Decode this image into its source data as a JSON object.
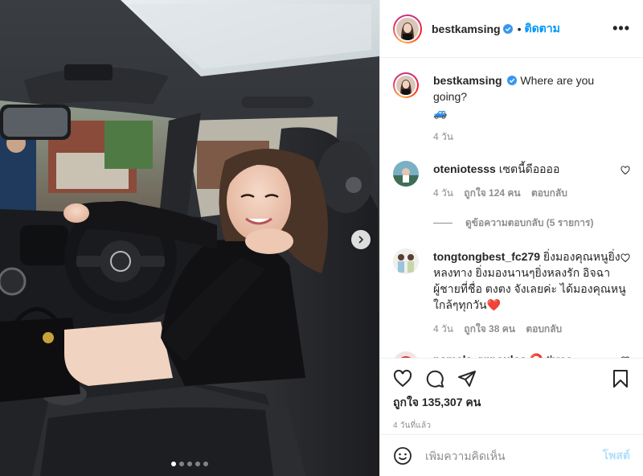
{
  "header": {
    "username": "bestkamsing",
    "dot": "•",
    "follow_label": "ติดตาม",
    "more_label": "•••"
  },
  "caption": {
    "username": "bestkamsing",
    "text": "Where are you going?",
    "emoji": "🚙",
    "time": "4 วัน"
  },
  "comments": [
    {
      "username": "oteniotesss",
      "text": "เซตนี้ดีออออ",
      "time": "4 วัน",
      "likes": "ถูกใจ 124 คน",
      "reply_label": "ตอบกลับ"
    },
    {
      "username": "tongtongbest_fc279",
      "text": "ยิ่งมองคุณหนูยิ่งหลงทาง ยิ่งมองนานๆยิ่งหลงรัก อิจฉาผู้ชายที่ชื่อ ตงตง จังเลยค่ะ ได้มองคุณหนูใกล้ๆทุกวัน",
      "emoji": "❤️",
      "time": "4 วัน",
      "likes": "ถูกใจ 38 คน",
      "reply_label": "ตอบกลับ"
    },
    {
      "username": "pamela_rgpoulos",
      "emoji": "⭕",
      "text": "three"
    }
  ],
  "view_replies": "ดูข้อความตอบกลับ (5 รายการ)",
  "actions": {
    "like_icon": "heart-icon",
    "comment_icon": "comment-icon",
    "share_icon": "share-icon",
    "save_icon": "bookmark-icon"
  },
  "likes_text": "ถูกใจ 135,307 คน",
  "posted_ago": "4 วันที่แล้ว",
  "add_comment": {
    "placeholder": "เพิ่มความคิดเห็น",
    "post_label": "โพสต์"
  },
  "carousel": {
    "total": 5,
    "active": 1
  },
  "colors": {
    "accent": "#0095f6",
    "muted": "#8e8e8e",
    "post_disabled": "#b2dffc",
    "verified": "#3897f0"
  }
}
